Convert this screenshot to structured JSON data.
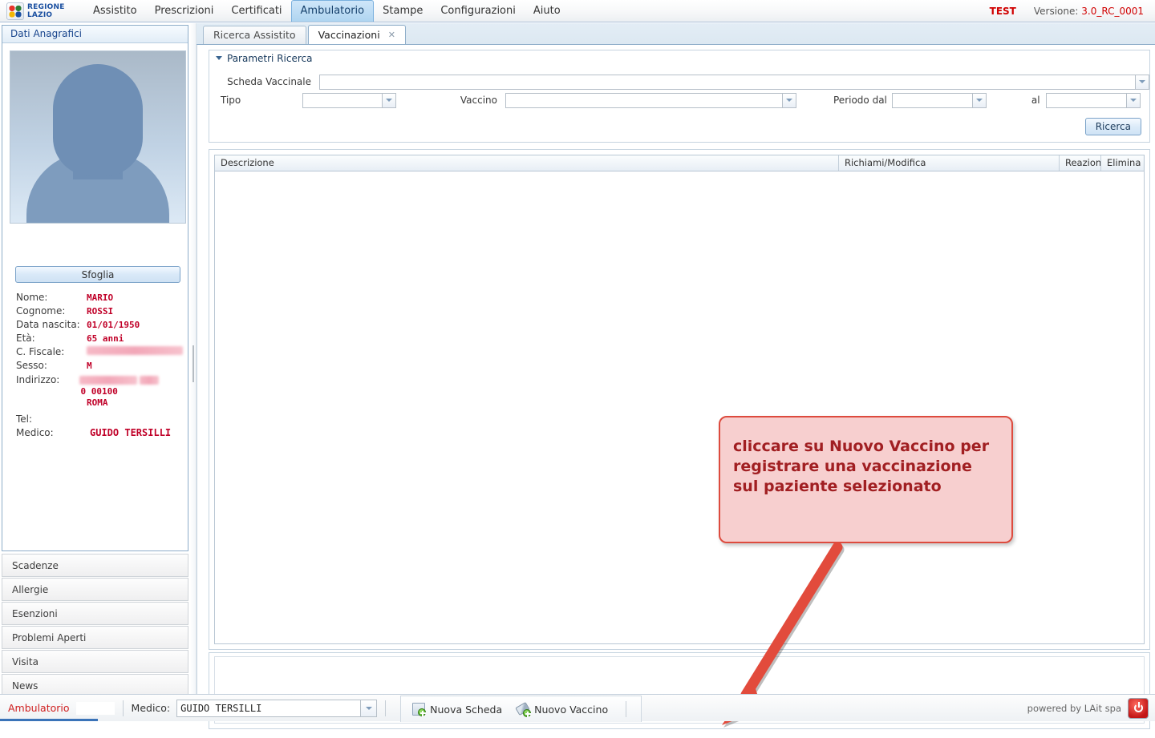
{
  "topbar": {
    "logo_line1": "REGIONE",
    "logo_line2": "LAZIO",
    "menu": [
      {
        "label": "Assistito",
        "active": false
      },
      {
        "label": "Prescrizioni",
        "active": false
      },
      {
        "label": "Certificati",
        "active": false
      },
      {
        "label": "Ambulatorio",
        "active": true
      },
      {
        "label": "Stampe",
        "active": false
      },
      {
        "label": "Configurazioni",
        "active": false
      },
      {
        "label": "Aiuto",
        "active": false
      }
    ],
    "environment": "TEST",
    "version_label": "Versione:",
    "version_value": "3.0_RC_0001"
  },
  "sidebar": {
    "panel_title": "Dati Anagrafici",
    "browse_button": "Sfoglia",
    "fields": [
      {
        "label": "Nome:",
        "value": "MARIO",
        "redacted": false
      },
      {
        "label": "Cognome:",
        "value": "ROSSI",
        "redacted": false
      },
      {
        "label": "Data nascita:",
        "value": "01/01/1950",
        "redacted": false
      },
      {
        "label": "Età:",
        "value": "65 anni",
        "redacted": false
      },
      {
        "label": "C. Fiscale:",
        "value": "",
        "redacted": true
      },
      {
        "label": "Sesso:",
        "value": "M",
        "redacted": false
      },
      {
        "label": "Indirizzo:",
        "value": "0 00100",
        "redacted": true
      },
      {
        "label": "",
        "value": "ROMA",
        "redacted": false
      },
      {
        "label": "Tel:",
        "value": "",
        "redacted": false
      },
      {
        "label": "Medico:",
        "value": "GUIDO TERSILLI",
        "redacted": false
      }
    ],
    "accordion": [
      "Scadenze",
      "Allergie",
      "Esenzioni",
      "Problemi Aperti",
      "Visita",
      "News"
    ]
  },
  "tabs": [
    {
      "label": "Ricerca Assistito",
      "active": false,
      "closable": false
    },
    {
      "label": "Vaccinazioni",
      "active": true,
      "closable": true,
      "close_glyph": "✕"
    }
  ],
  "search": {
    "section_title": "Parametri Ricerca",
    "scheda_label": "Scheda Vaccinale",
    "scheda_value": "",
    "tipo_label": "Tipo",
    "tipo_value": "",
    "vaccino_label": "Vaccino",
    "vaccino_value": "",
    "periodo_dal_label": "Periodo dal",
    "periodo_dal_value": "",
    "al_label": "al",
    "al_value": "",
    "search_button": "Ricerca"
  },
  "grid": {
    "columns": [
      "Descrizione",
      "Richiami/Modifica",
      "Reazion",
      "Elimina"
    ],
    "rows": []
  },
  "annotation": {
    "text": "cliccare su Nuovo Vaccino per registrare una vaccinazione sul paziente selezionato",
    "box_color": "#f7cfcf",
    "border_color": "#dd4b3e",
    "text_color": "#a11f22",
    "arrow_color": "#e24b3c"
  },
  "bottombar": {
    "section": "Ambulatorio",
    "medico_label": "Medico:",
    "medico_value": "GUIDO TERSILLI",
    "actions": [
      {
        "label": "Nuova Scheda",
        "icon": "new-document-icon"
      },
      {
        "label": "Nuovo Vaccino",
        "icon": "syringe-add-icon"
      }
    ],
    "powered_by": "powered by LAit spa"
  }
}
